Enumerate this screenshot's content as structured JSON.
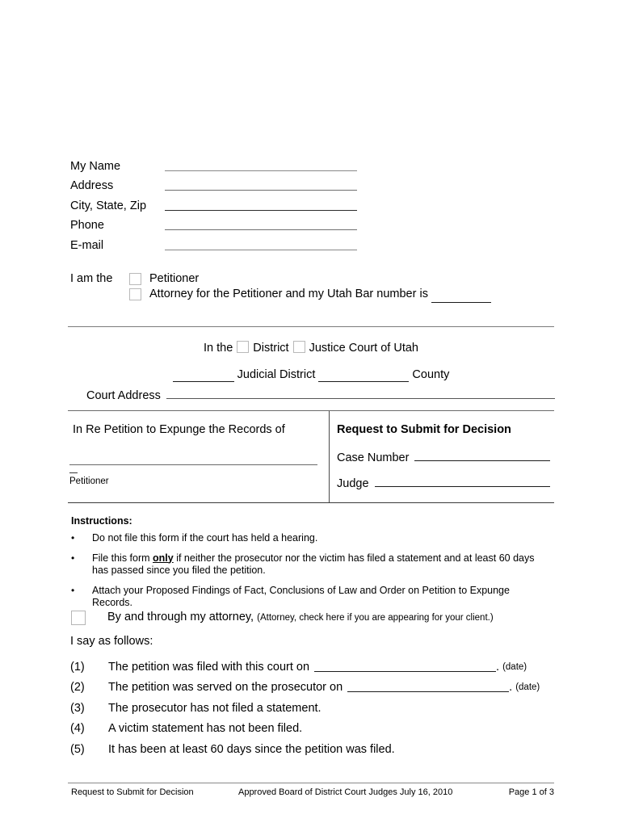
{
  "header_fields": [
    {
      "label": "My Name"
    },
    {
      "label": "Address"
    },
    {
      "label": "City, State, Zip"
    },
    {
      "label": "Phone"
    },
    {
      "label": "E-mail"
    }
  ],
  "role_section": {
    "lead": "I am the",
    "option_petitioner": "Petitioner",
    "option_attorney": "Attorney for the Petitioner and my Utah Bar number is"
  },
  "court": {
    "in_the": "In the",
    "district_label": "District",
    "justice_label": "Justice Court of Utah",
    "judicial_district": "Judicial District",
    "county": "County",
    "court_address_label": "Court Address"
  },
  "caption": {
    "in_re": "In Re Petition to Expunge the Records of",
    "petitioner_label": "Petitioner",
    "title": "Request to Submit for Decision",
    "case_number_label": "Case Number",
    "judge_label": "Judge"
  },
  "instructions": {
    "heading": "Instructions:",
    "bullet_marker": "•",
    "bullets": [
      {
        "text_before": "Do not file this form if the court has held a hearing.",
        "emphasis": "",
        "text_after": ""
      },
      {
        "text_before": "File this form ",
        "emphasis": "only",
        "text_after": " if neither the prosecutor nor the victim has filed a statement and at least 60 days has passed since you filed the petition."
      },
      {
        "text_before": "Attach your Proposed Findings of Fact, Conclusions of Law and Order on Petition to Expunge Records.",
        "emphasis": "",
        "text_after": ""
      }
    ]
  },
  "attorney_check": {
    "label": "By and through my attorney,",
    "note": "(Attorney, check here if you are appearing for your client.)"
  },
  "statements": {
    "lead": "I say as follows:",
    "items": [
      {
        "num": "(1)",
        "text": "The petition was filed with this court on",
        "has_blank": true,
        "tail": ".",
        "note": "(date)"
      },
      {
        "num": "(2)",
        "text": "The petition was served on the prosecutor on",
        "has_blank": true,
        "tail": ".",
        "note": "(date)"
      },
      {
        "num": "(3)",
        "text": "The prosecutor has not filed a statement.",
        "has_blank": false,
        "tail": "",
        "note": ""
      },
      {
        "num": "(4)",
        "text": "A victim statement has not been filed.",
        "has_blank": false,
        "tail": "",
        "note": ""
      },
      {
        "num": "(5)",
        "text": "It has been at least 60 days since the petition was filed.",
        "has_blank": false,
        "tail": "",
        "note": ""
      }
    ]
  },
  "footer": {
    "left": "Request to Submit for Decision",
    "middle": "Approved Board of District Court Judges July 16, 2010",
    "right": "Page 1 of 3"
  }
}
